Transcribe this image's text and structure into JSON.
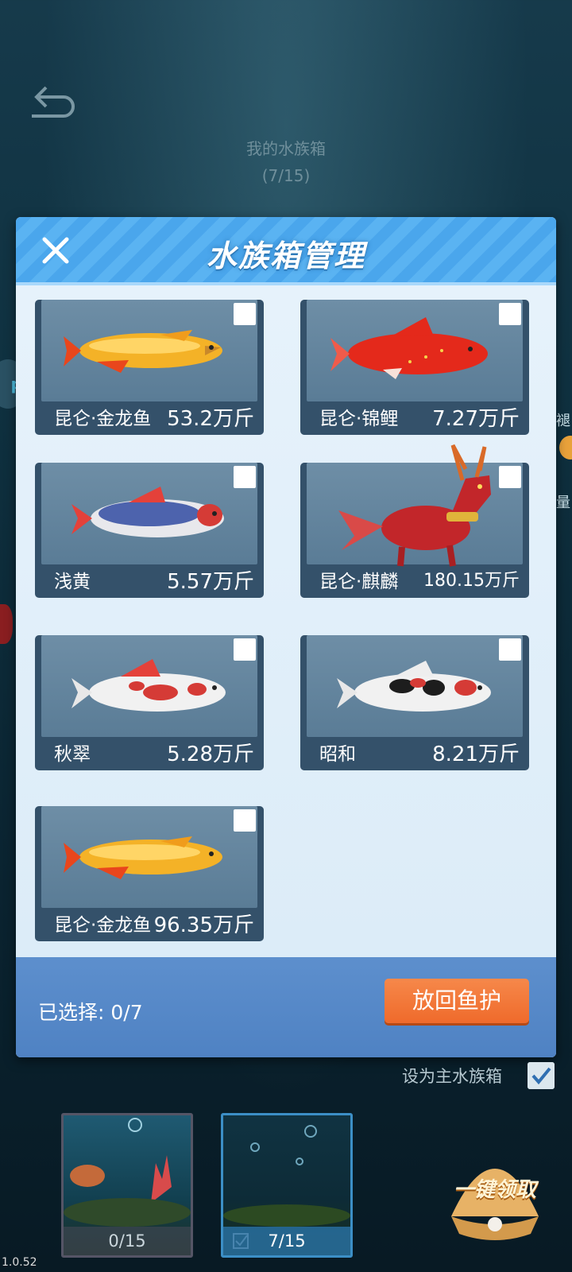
{
  "background": {
    "title": "我的水族箱",
    "count": "(7/15)",
    "left_badge": "p",
    "right_text_1": "褪",
    "right_text_2": "量"
  },
  "modal": {
    "title": "水族箱管理",
    "cards": [
      {
        "name": "昆仑·金龙鱼",
        "weight": "53.2万斤",
        "fish": "golden-arowana-icon"
      },
      {
        "name": "昆仑·锦鲤",
        "weight": "7.27万斤",
        "fish": "red-koi-icon"
      },
      {
        "name": "浅黄",
        "weight": "5.57万斤",
        "fish": "asagi-koi-icon"
      },
      {
        "name": "昆仑·麒麟",
        "weight": "180.15万斤",
        "fish": "qilin-icon"
      },
      {
        "name": "秋翠",
        "weight": "5.28万斤",
        "fish": "shusui-koi-icon"
      },
      {
        "name": "昭和",
        "weight": "8.21万斤",
        "fish": "showa-koi-icon"
      },
      {
        "name": "昆仑·金龙鱼",
        "weight": "96.35万斤",
        "fish": "golden-arowana-icon"
      }
    ],
    "footer": {
      "selected_label": "已选择: 0/7",
      "release_button": "放回鱼护"
    }
  },
  "bottom": {
    "set_main_label": "设为主水族箱",
    "tanks": [
      {
        "label": "0/15"
      },
      {
        "label": "7/15"
      }
    ],
    "claim_button": "一键领取",
    "version": "1.0.52"
  },
  "colors": {
    "header_blue": "#4aa6ec",
    "footer_blue": "#4f82c3",
    "release_orange": "#ef6a2b"
  }
}
